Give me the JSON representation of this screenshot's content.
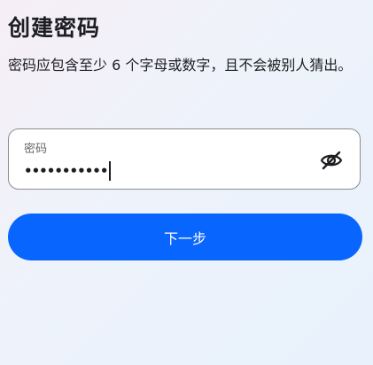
{
  "page": {
    "title": "创建密码",
    "subtitle": "密码应包含至少 6 个字母或数字，且不会被别人猜出。"
  },
  "password_field": {
    "label": "密码",
    "value_masked": "•••••••••••",
    "visibility_icon": "eye-slash-icon"
  },
  "actions": {
    "next_label": "下一步"
  },
  "colors": {
    "primary": "#0866ff",
    "text": "#1c1e21",
    "muted": "#65676b",
    "field_border": "#8a8d91"
  }
}
